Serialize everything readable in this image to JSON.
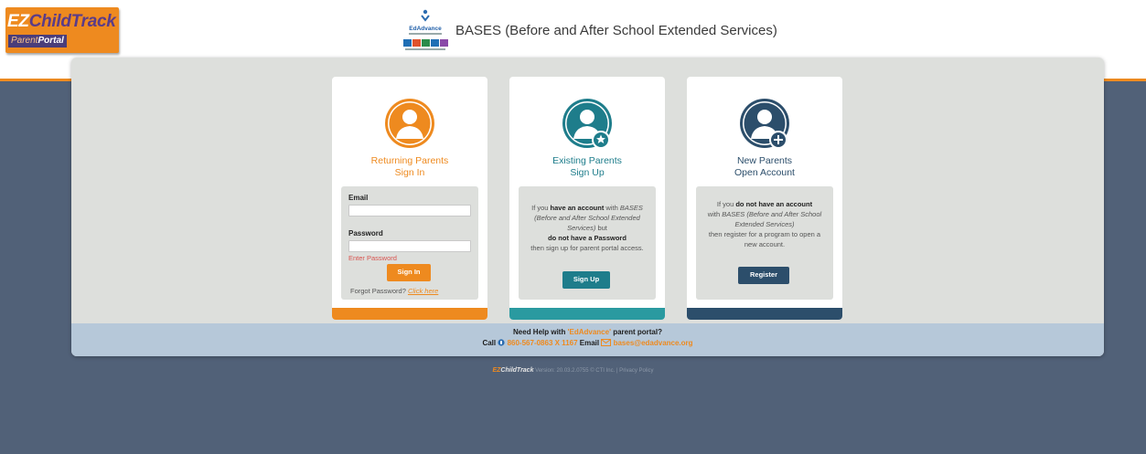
{
  "header": {
    "logo_ez": "EZ",
    "logo_ct": "ChildTrack",
    "logo_parent": "Parent",
    "logo_portal": "Portal",
    "edadvance_logo_text": "EdAdvance",
    "title": "BASES (Before and After School Extended Services)"
  },
  "cards": {
    "returning": {
      "title_line1": "Returning Parents",
      "title_line2": "Sign In",
      "email_label": "Email",
      "email_value": "",
      "password_label": "Password",
      "password_value": "",
      "error_text": "Enter Password",
      "signin_button": "Sign In",
      "forgot_text": "Forgot Password?",
      "forgot_link": "Click here",
      "color": "#ee8a1f"
    },
    "existing": {
      "title_line1": "Existing Parents",
      "title_line2": "Sign Up",
      "text_if": "If you",
      "text_have": "have an account",
      "text_with": "with",
      "text_org": "BASES (Before and After School Extended Services)",
      "text_but": "but",
      "text_donot": "do not have a Password",
      "text_then": "then sign up for parent portal access.",
      "signup_button": "Sign Up",
      "color": "#1e7d8b"
    },
    "new": {
      "title_line1": "New Parents",
      "title_line2": "Open Account",
      "text_if": "If you",
      "text_donot": "do not have an account",
      "text_with": "with",
      "text_org": "BASES (Before and After School Extended Services)",
      "text_then": "then register for a program to open a new account.",
      "register_button": "Register",
      "color": "#2c4e6b"
    }
  },
  "help": {
    "line1_pre": "Need Help with",
    "line1_brand": "'EdAdvance'",
    "line1_post": "parent portal?",
    "call_label": "Call",
    "phone": "860-567-0863 X 1167",
    "email_label": "Email",
    "email": "bases@edadvance.org"
  },
  "footer": {
    "brand_ez": "EZ",
    "brand_ct": "ChildTrack",
    "version_text": "Version: 20.03.2.0755 © CTI Inc. | Privacy Policy"
  }
}
